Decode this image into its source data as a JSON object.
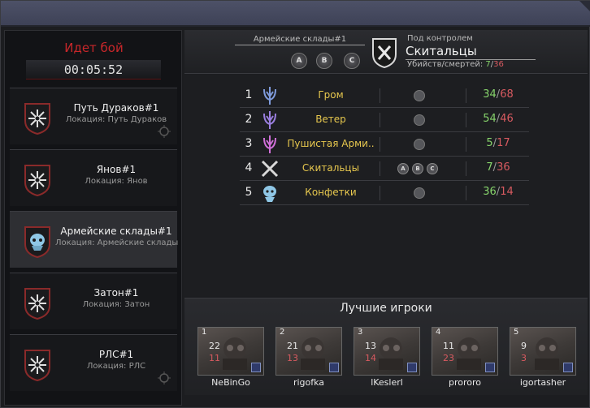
{
  "left_panel": {
    "status_title": "Идет бой",
    "timer": "00:05:52",
    "locations": [
      {
        "name": "Путь Дураков#1",
        "sub": "Локация: Путь Дураков",
        "emblem": "star-shield-icon",
        "active": false
      },
      {
        "name": "Янов#1",
        "sub": "Локация: Янов",
        "emblem": "star-shield-icon",
        "active": false
      },
      {
        "name": "Армейские склады#1",
        "sub": "Локация: Армейские склады",
        "emblem": "alien-head-icon",
        "active": true
      },
      {
        "name": "Затон#1",
        "sub": "Локация: Затон",
        "emblem": "star-shield-icon",
        "active": false
      },
      {
        "name": "РЛС#1",
        "sub": "Локация: РЛС",
        "emblem": "star-shield-icon",
        "active": false
      }
    ]
  },
  "header": {
    "zone": "Армейские склады#1",
    "points": [
      "A",
      "B",
      "C"
    ],
    "control_label": "Под контролем",
    "control_faction": "Скитальцы",
    "kd_label": "Убийств/смертей:",
    "kd_kills": "7",
    "kd_slash": "/",
    "kd_deaths": "36"
  },
  "ranking": [
    {
      "rank": "1",
      "name": "Гром",
      "kills": "34",
      "deaths": "68",
      "icon": "trident-icon",
      "color": "#7f9bdc",
      "points": []
    },
    {
      "rank": "2",
      "name": "Ветер",
      "kills": "54",
      "deaths": "46",
      "icon": "trident-icon",
      "color": "#9b7fe0",
      "points": []
    },
    {
      "rank": "3",
      "name": "Пушистая Арми..",
      "kills": "5",
      "deaths": "17",
      "icon": "trident-icon",
      "color": "#d06fd8",
      "points": []
    },
    {
      "rank": "4",
      "name": "Скитальцы",
      "kills": "7",
      "deaths": "36",
      "icon": "crossed-swords-icon",
      "color": "#d8d8d8",
      "points": [
        "A",
        "B",
        "C"
      ]
    },
    {
      "rank": "5",
      "name": "Конфетки",
      "kills": "36",
      "deaths": "14",
      "icon": "alien-head-icon",
      "color": "#8fc7e6",
      "points": []
    }
  ],
  "best": {
    "title": "Лучшие игроки",
    "players": [
      {
        "rank": "1",
        "kills": "22",
        "deaths": "11",
        "name": "NeBinGo"
      },
      {
        "rank": "2",
        "kills": "21",
        "deaths": "13",
        "name": "rigofka"
      },
      {
        "rank": "3",
        "kills": "13",
        "deaths": "14",
        "name": "lKeslerl"
      },
      {
        "rank": "4",
        "kills": "11",
        "deaths": "23",
        "name": "prororo"
      },
      {
        "rank": "5",
        "kills": "9",
        "deaths": "3",
        "name": "igortasher"
      }
    ]
  },
  "colors": {
    "accent_red": "#c8272a",
    "kills_green": "#86d36b",
    "deaths_red": "#d85a60",
    "faction_gold": "#e6c74e"
  }
}
